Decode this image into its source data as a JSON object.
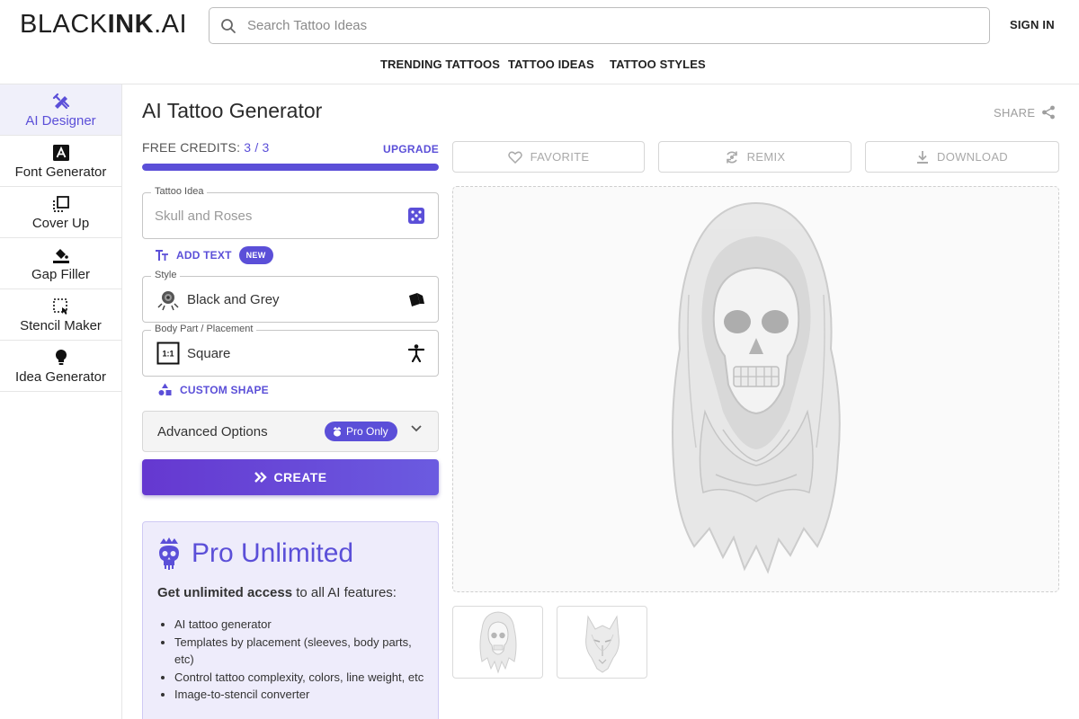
{
  "app": {
    "logo_part1": "BLACK",
    "logo_part2": "INK",
    "logo_part3": ".AI"
  },
  "header": {
    "search_placeholder": "Search Tattoo Ideas",
    "sign_in": "SIGN IN",
    "nav": [
      "TRENDING TATTOOS",
      "TATTOO IDEAS",
      "TATTOO STYLES"
    ]
  },
  "sidebar": {
    "items": [
      {
        "label": "AI Designer",
        "icon": "ai-designer-icon",
        "active": true
      },
      {
        "label": "Font Generator",
        "icon": "font-icon",
        "active": false
      },
      {
        "label": "Cover Up",
        "icon": "cover-up-icon",
        "active": false
      },
      {
        "label": "Gap Filler",
        "icon": "paint-bucket-icon",
        "active": false
      },
      {
        "label": "Stencil Maker",
        "icon": "stencil-icon",
        "active": false
      },
      {
        "label": "Idea Generator",
        "icon": "lightbulb-icon",
        "active": false
      }
    ]
  },
  "main": {
    "title": "AI Tattoo Generator",
    "share": "SHARE",
    "credits_label": "FREE CREDITS:",
    "credits_value": "3 / 3",
    "credits_fraction": 1.0,
    "upgrade": "UPGRADE",
    "tattoo_idea": {
      "legend": "Tattoo Idea",
      "placeholder": "Skull and Roses",
      "value": ""
    },
    "add_text": "ADD TEXT",
    "new_badge": "NEW",
    "style": {
      "legend": "Style",
      "value": "Black and Grey"
    },
    "placement": {
      "legend": "Body Part / Placement",
      "value": "Square",
      "ratio_label": "1:1"
    },
    "custom_shape": "CUSTOM SHAPE",
    "advanced": {
      "label": "Advanced Options",
      "badge": "Pro Only"
    },
    "create": "CREATE"
  },
  "pro_card": {
    "title": "Pro Unlimited",
    "desc_bold": "Get unlimited access",
    "desc_rest": " to all AI features:",
    "features": [
      "AI tattoo generator",
      "Templates by placement (sleeves, body parts, etc)",
      "Control tattoo complexity, colors, line weight, etc",
      "Image-to-stencil converter"
    ]
  },
  "actions": {
    "favorite": "FAVORITE",
    "remix": "REMIX",
    "download": "DOWNLOAD"
  },
  "colors": {
    "accent": "#5b4fd8",
    "muted": "#a9a9a9",
    "active_bg": "#f0f0fa"
  }
}
